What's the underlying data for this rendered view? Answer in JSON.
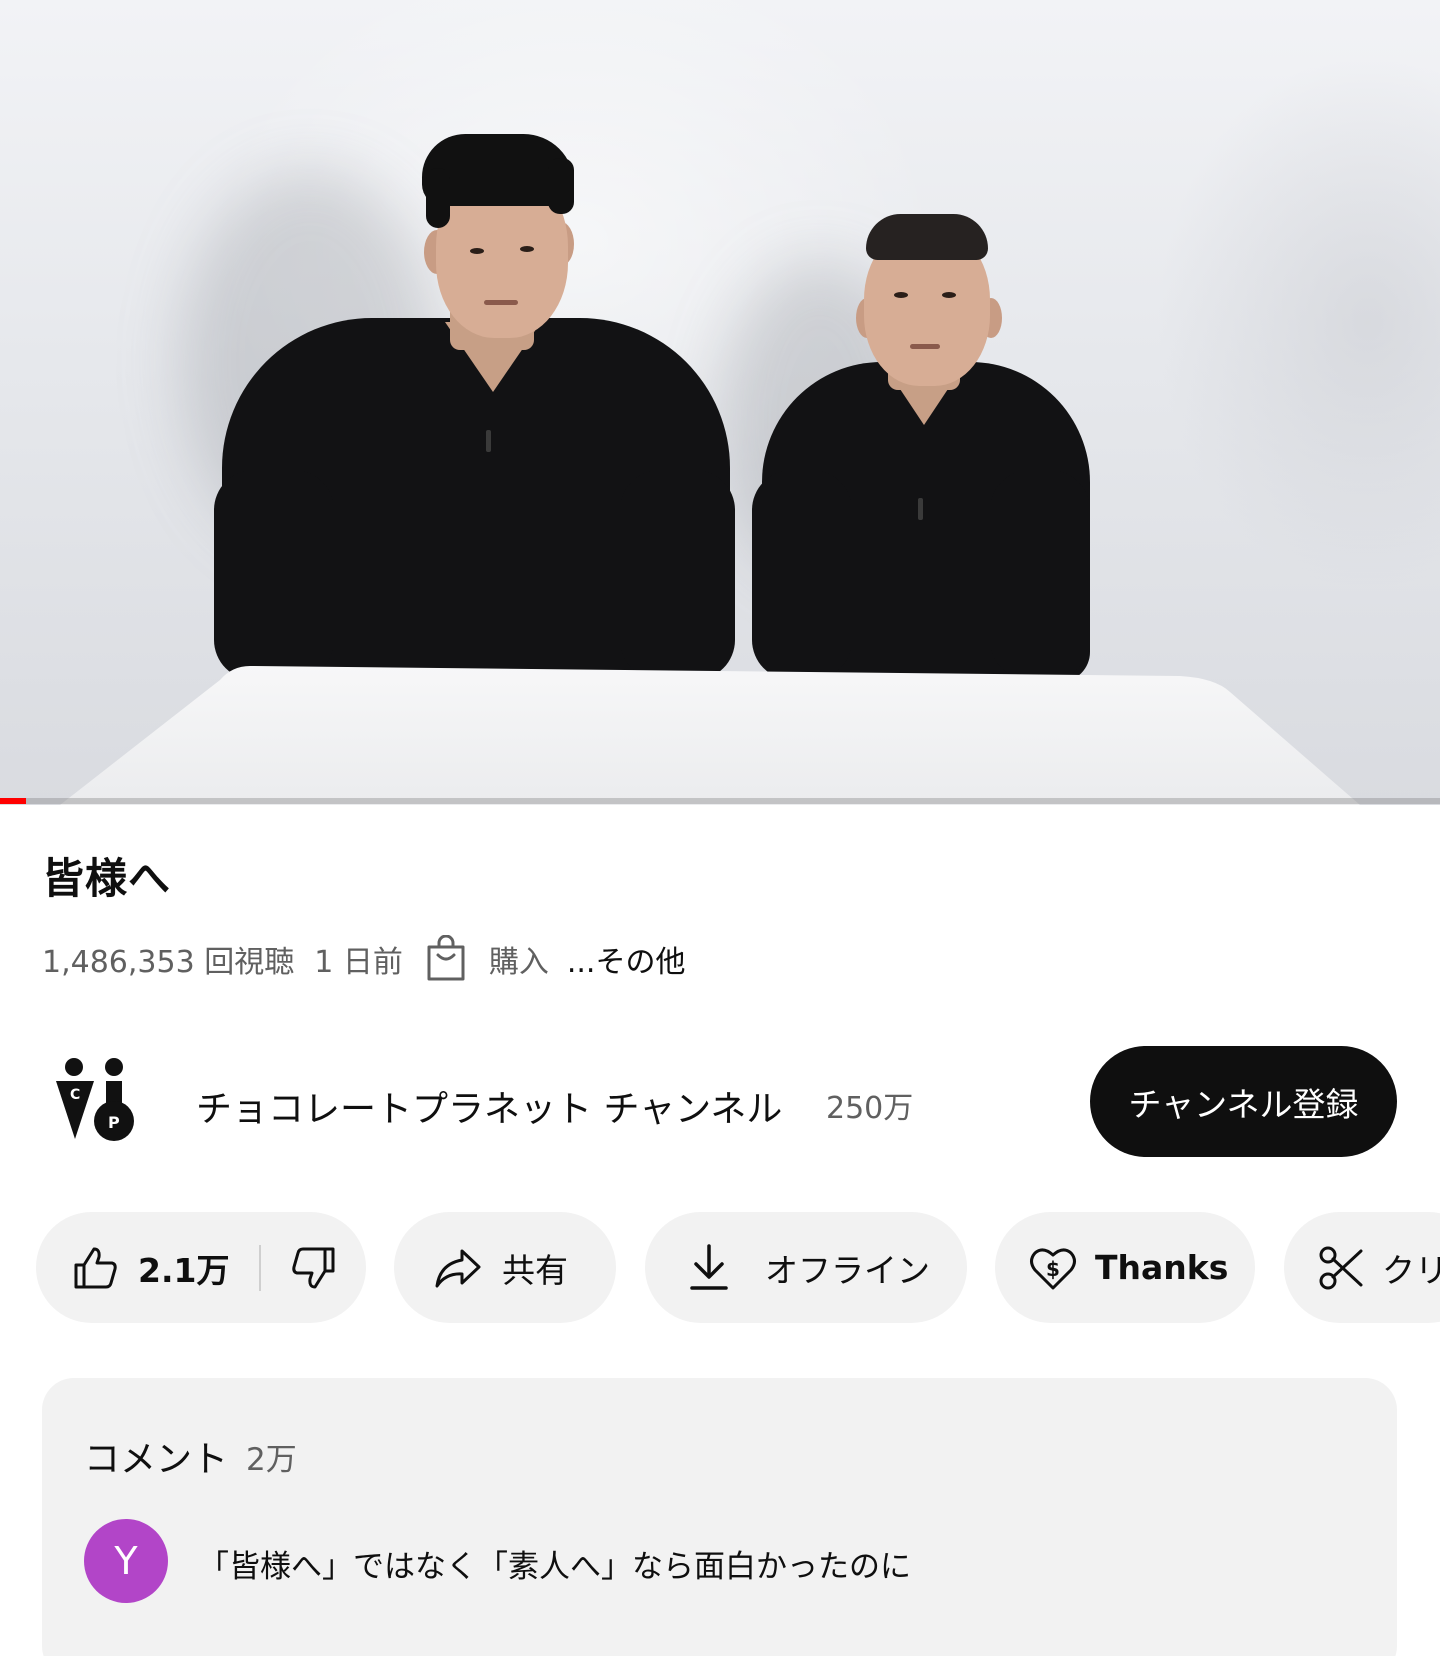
{
  "video": {
    "progress_fraction": 0.018
  },
  "title": "皆様へ",
  "meta": {
    "views": "1,486,353 回視聴",
    "age": "1 日前",
    "buy_label": "購入",
    "more_label": "...その他"
  },
  "channel": {
    "name": "チョコレートプラネット チャンネル",
    "subscribers": "250万",
    "subscribe_label": "チャンネル登録",
    "logo_letters": [
      "C",
      "P"
    ]
  },
  "actions": {
    "like_count": "2.1万",
    "share_label": "共有",
    "download_label": "オフライン",
    "thanks_label": "Thanks",
    "clip_label": "クリ"
  },
  "comments": {
    "title": "コメント",
    "count": "2万",
    "top_comment": {
      "avatar_letter": "Y",
      "avatar_color": "#b245c8",
      "text": "「皆様へ」ではなく「素人へ」なら面白かったのに"
    }
  },
  "colors": {
    "accent": "#ff0000",
    "subscribe_bg": "#0f0f0f",
    "pill_bg": "#f2f2f2"
  },
  "icons": [
    "shopping-bag-icon",
    "thumbs-up-icon",
    "thumbs-down-icon",
    "share-icon",
    "download-icon",
    "thanks-icon",
    "scissors-icon"
  ]
}
